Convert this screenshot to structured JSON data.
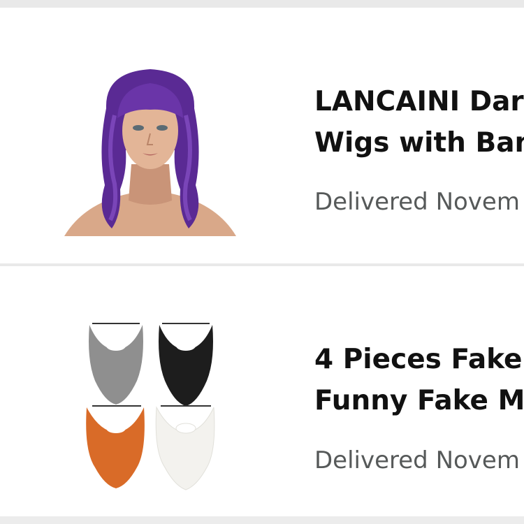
{
  "orders": [
    {
      "image_icon": "purple-wig-product-image",
      "title_line1": "LANCAINI Dar",
      "title_line2": "Wigs with Ban",
      "status": "Delivered Novem"
    },
    {
      "image_icon": "fake-beards-product-image",
      "title_line1": "4 Pieces Fake",
      "title_line2": "Funny Fake Mu",
      "status": "Delivered Novem"
    }
  ],
  "colors": {
    "card_background": "#ffffff",
    "page_background": "#e9e9e9",
    "title_text": "#111111",
    "status_text": "#565959"
  }
}
